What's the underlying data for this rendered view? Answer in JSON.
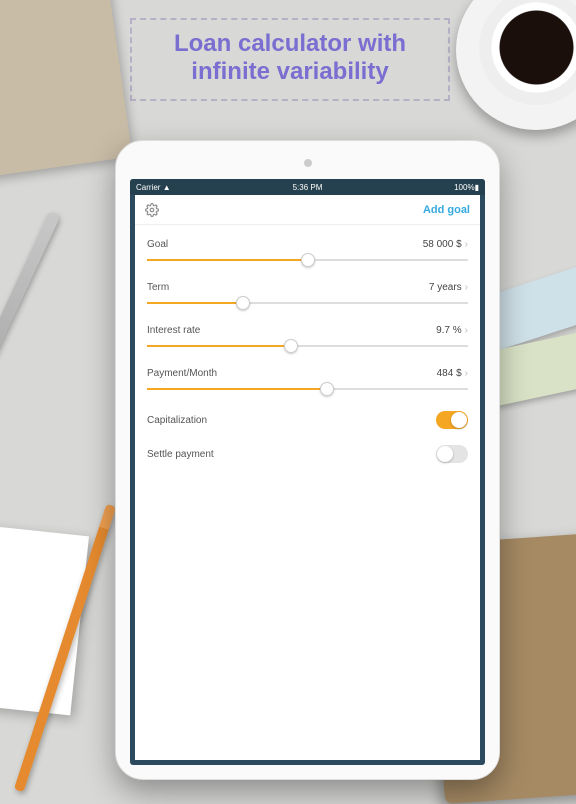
{
  "marketing_title": "Loan calculator with infinite variability",
  "statusbar": {
    "carrier": "Carrier",
    "wifi": "᯾",
    "time": "5:36 PM",
    "battery": "100%▮"
  },
  "navbar": {
    "gear_icon": "gear-icon",
    "add_goal": "Add goal"
  },
  "sliders": {
    "goal": {
      "label": "Goal",
      "value": "58 000 $",
      "pct": 50
    },
    "term": {
      "label": "Term",
      "value": "7 years",
      "pct": 30
    },
    "rate": {
      "label": "Interest rate",
      "value": "9.7 %",
      "pct": 45
    },
    "payment": {
      "label": "Payment/Month",
      "value": "484 $",
      "pct": 56
    }
  },
  "toggles": {
    "capitalization": {
      "label": "Capitalization",
      "on": true
    },
    "settle": {
      "label": "Settle payment",
      "on": false
    }
  },
  "colors": {
    "accent_orange": "#f5a623",
    "accent_blue": "#35a9e0",
    "title_purple": "#7b6ed1"
  }
}
